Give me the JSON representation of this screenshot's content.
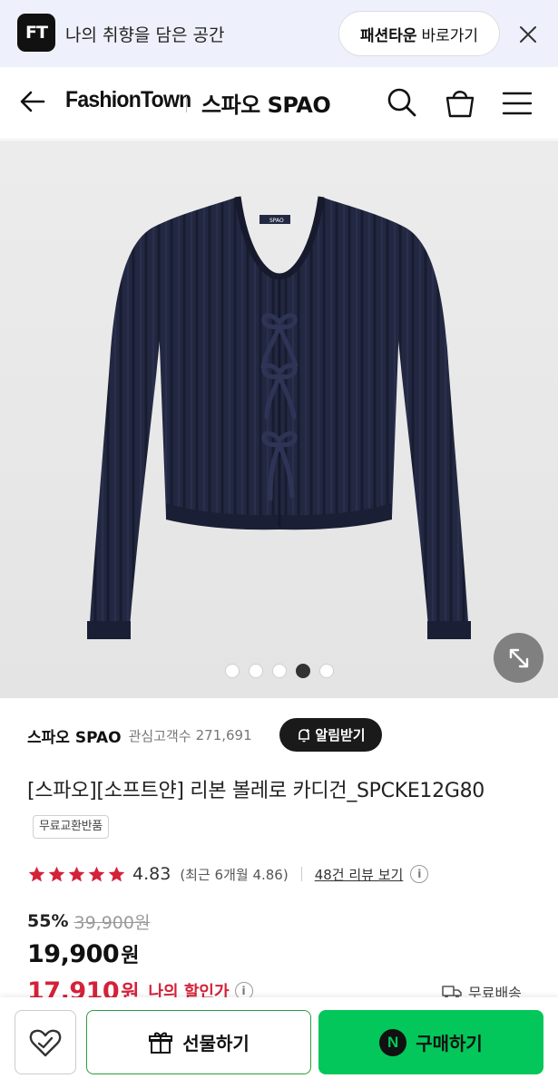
{
  "promo": {
    "logo_text": "FT",
    "message": "나의 취향을 담은 공간",
    "button_bold": "패션타운",
    "button_light": "바로가기"
  },
  "header": {
    "site_name": "FashionTown",
    "store_name": "스파오 SPAO"
  },
  "gallery": {
    "total_images": 5,
    "active_index": 3,
    "label_on_garment": "SPAO"
  },
  "product": {
    "brand": "스파오 SPAO",
    "fans_label": "관심고객수",
    "fans_count": "271,691",
    "alert_button": "알림받기",
    "title": "[스파오][소프트얀] 리본 볼레로 카디건_SPCKE12G80",
    "badge": "무료교환반품",
    "rating": {
      "stars": 5,
      "score": "4.83",
      "recent": "(최근 6개월 4.86)",
      "review_link": "48건 리뷰 보기",
      "star_color": "#d4223a"
    },
    "price": {
      "discount": "55%",
      "original": "39,900원",
      "current": "19,900",
      "current_unit": "원",
      "my_price": "17,910",
      "my_price_unit": "원",
      "my_price_label": "나의 할인가",
      "shipping": "무료배송"
    }
  },
  "bottom_bar": {
    "gift_label": "선물하기",
    "buy_label": "구매하기",
    "buy_color": "#03c75a",
    "naver_logo": "N"
  },
  "info_glyph": "i"
}
